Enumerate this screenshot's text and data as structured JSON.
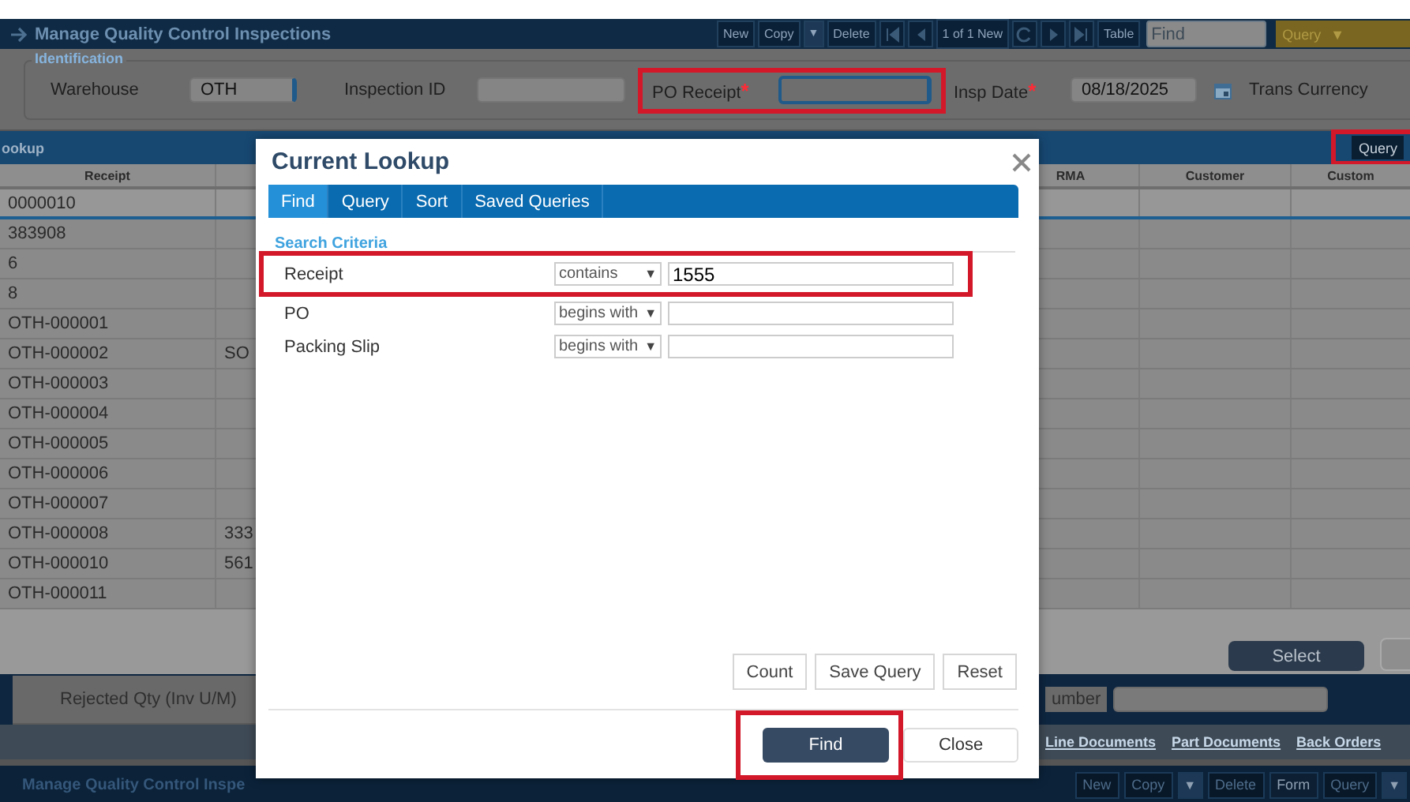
{
  "header": {
    "title": "Manage Quality Control Inspections",
    "toolbar": [
      {
        "kind": "button",
        "label": "New"
      },
      {
        "kind": "button",
        "label": "Copy"
      },
      {
        "kind": "caret",
        "label": "▼"
      },
      {
        "kind": "button",
        "label": "Delete"
      },
      {
        "kind": "nav-first"
      },
      {
        "kind": "nav-prev"
      },
      {
        "kind": "counter",
        "label": "1 of 1 New"
      },
      {
        "kind": "nav-refresh"
      },
      {
        "kind": "nav-next"
      },
      {
        "kind": "nav-last"
      },
      {
        "kind": "button",
        "label": "Table"
      }
    ],
    "find": {
      "placeholder": "Find"
    },
    "query": {
      "label": "Query",
      "caret": "▼"
    }
  },
  "identification": {
    "legend": "Identification",
    "fields": [
      {
        "kind": "text",
        "label": "Warehouse",
        "value": "OTH",
        "highlighted": false
      },
      {
        "kind": "text",
        "label": "Inspection ID",
        "highlighted": false
      },
      {
        "kind": "text",
        "label": "PO Receipt",
        "required_mark": "*",
        "highlighted": true
      },
      {
        "kind": "date",
        "label": "Insp Date",
        "required_mark": "*",
        "value": "08/18/2025",
        "highlighted": false
      },
      {
        "kind": "label",
        "label": "Trans Currency",
        "highlighted": false
      }
    ]
  },
  "lookup": {
    "title": "ookup",
    "query_button": {
      "label": "Query",
      "highlighted": true
    },
    "columns": [
      {
        "label": "Receipt"
      },
      {
        "label": "RMA"
      },
      {
        "label": "Customer"
      },
      {
        "label": "Custom"
      }
    ],
    "rows": [
      {
        "receipt": "0000010",
        "selected": true
      },
      {
        "receipt": "383908",
        "selected": false
      },
      {
        "receipt": "6",
        "selected": false
      },
      {
        "receipt": "8",
        "selected": false
      },
      {
        "receipt": "OTH-000001",
        "selected": false
      },
      {
        "receipt": "OTH-000002",
        "column_2": "SO",
        "selected": false
      },
      {
        "receipt": "OTH-000003",
        "selected": false
      },
      {
        "receipt": "OTH-000004",
        "selected": false
      },
      {
        "receipt": "OTH-000005",
        "selected": false
      },
      {
        "receipt": "OTH-000006",
        "selected": false
      },
      {
        "receipt": "OTH-000007",
        "selected": false
      },
      {
        "receipt": "OTH-000008",
        "column_2": "333",
        "selected": false
      },
      {
        "receipt": "OTH-000010",
        "column_2": "561",
        "selected": false
      },
      {
        "receipt": "OTH-000011",
        "selected": false
      }
    ],
    "select_button": "Select"
  },
  "rejection": {
    "qty_label": "Rejected Qty (Inv U/M)",
    "number_label": "umber",
    "links": [
      "Line Documents",
      "Part Documents",
      "Back Orders"
    ]
  },
  "footer": {
    "title": "Manage Quality Control Inspe",
    "toolbar": [
      {
        "kind": "button",
        "label": "New",
        "disabled": true
      },
      {
        "kind": "button",
        "label": "Copy",
        "disabled": true
      },
      {
        "kind": "caret",
        "label": "▼",
        "disabled": false
      },
      {
        "kind": "button",
        "label": "Delete",
        "disabled": true
      },
      {
        "kind": "button",
        "label": "Form",
        "disabled": false
      },
      {
        "kind": "button",
        "label": "Query",
        "disabled": true
      },
      {
        "kind": "caret",
        "label": "▼",
        "disabled": false
      }
    ]
  },
  "dialog": {
    "title": "Current Lookup",
    "tabs": [
      {
        "label": "Find",
        "selected": true
      },
      {
        "label": "Query",
        "selected": false
      },
      {
        "label": "Sort",
        "selected": false
      },
      {
        "label": "Saved Queries",
        "selected": false
      }
    ],
    "section": "Search Criteria",
    "criteria": [
      {
        "label": "Receipt",
        "operator": "contains",
        "caret": "▼",
        "value": "1555",
        "highlighted": true
      },
      {
        "label": "PO",
        "operator": "begins with",
        "caret": "▼",
        "highlighted": false
      },
      {
        "label": "Packing Slip",
        "operator": "begins with",
        "caret": "▼",
        "highlighted": false
      }
    ],
    "actions": [
      "Count",
      "Save Query",
      "Reset"
    ],
    "footer_buttons": [
      {
        "kind": "primary",
        "label": "Find",
        "highlighted": true
      },
      {
        "kind": "secondary",
        "label": "Close",
        "highlighted": false
      }
    ]
  }
}
